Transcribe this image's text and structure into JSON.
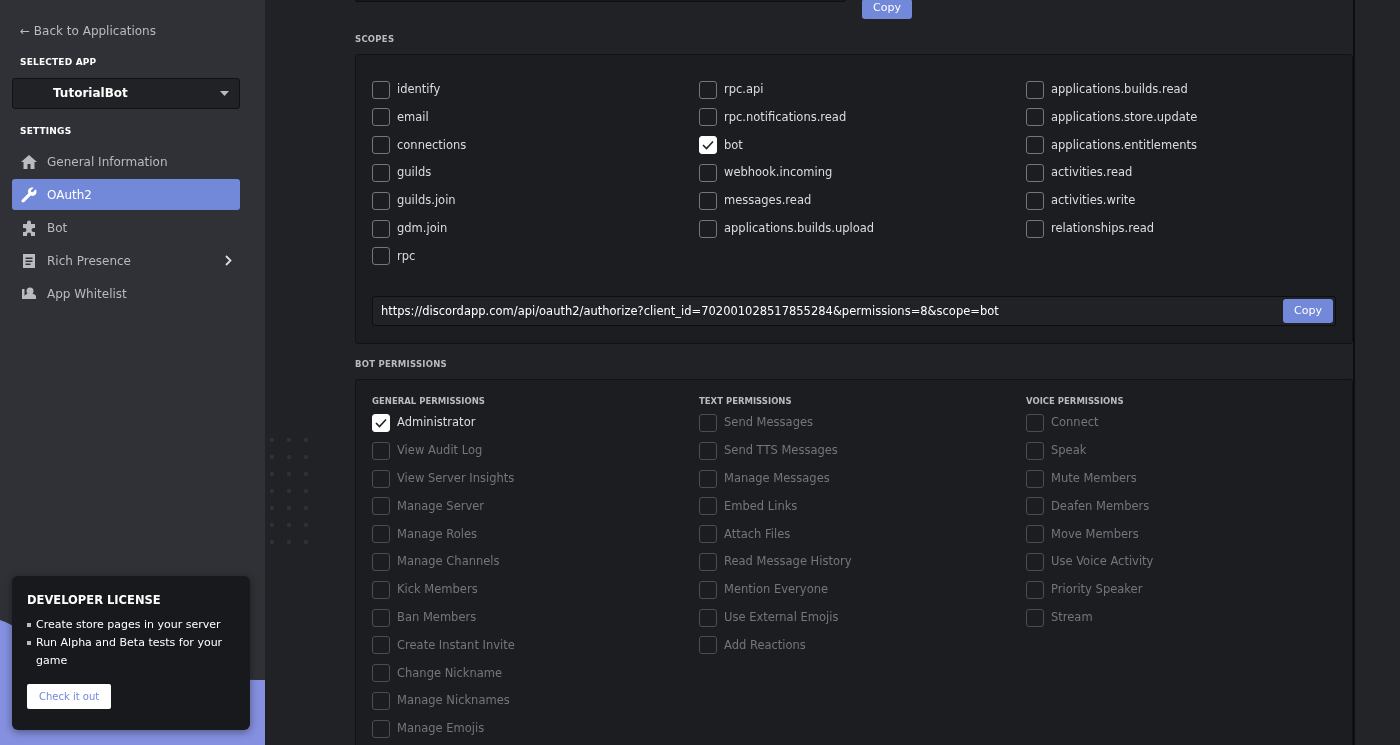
{
  "sidebar": {
    "back_link": "← Back to Applications",
    "selected_app_label": "SELECTED APP",
    "selected_app": "TutorialBot",
    "settings_label": "SETTINGS",
    "items": [
      {
        "label": "General Information",
        "selected": false,
        "expandable": false
      },
      {
        "label": "OAuth2",
        "selected": true,
        "expandable": false
      },
      {
        "label": "Bot",
        "selected": false,
        "expandable": false
      },
      {
        "label": "Rich Presence",
        "selected": false,
        "expandable": true
      },
      {
        "label": "App Whitelist",
        "selected": false,
        "expandable": false
      }
    ],
    "license_card": {
      "title": "DEVELOPER LICENSE",
      "bullets": [
        "Create store pages in your server",
        "Run Alpha and Beta tests for your game"
      ],
      "button": "Check it out"
    }
  },
  "top_copy_button": "Copy",
  "scopes": {
    "title": "SCOPES",
    "columns": [
      [
        {
          "label": "identify",
          "checked": false
        },
        {
          "label": "email",
          "checked": false
        },
        {
          "label": "connections",
          "checked": false
        },
        {
          "label": "guilds",
          "checked": false
        },
        {
          "label": "guilds.join",
          "checked": false
        },
        {
          "label": "gdm.join",
          "checked": false
        },
        {
          "label": "rpc",
          "checked": false
        }
      ],
      [
        {
          "label": "rpc.api",
          "checked": false
        },
        {
          "label": "rpc.notifications.read",
          "checked": false
        },
        {
          "label": "bot",
          "checked": true
        },
        {
          "label": "webhook.incoming",
          "checked": false
        },
        {
          "label": "messages.read",
          "checked": false
        },
        {
          "label": "applications.builds.upload",
          "checked": false
        }
      ],
      [
        {
          "label": "applications.builds.read",
          "checked": false
        },
        {
          "label": "applications.store.update",
          "checked": false
        },
        {
          "label": "applications.entitlements",
          "checked": false
        },
        {
          "label": "activities.read",
          "checked": false
        },
        {
          "label": "activities.write",
          "checked": false
        },
        {
          "label": "relationships.read",
          "checked": false
        }
      ]
    ],
    "url": "https://discordapp.com/api/oauth2/authorize?client_id=702001028517855284&permissions=8&scope=bot",
    "copy_button": "Copy"
  },
  "bot_permissions": {
    "title": "BOT PERMISSIONS",
    "groups": [
      {
        "title": "GENERAL PERMISSIONS",
        "items": [
          {
            "label": "Administrator",
            "checked": true,
            "disabled": false
          },
          {
            "label": "View Audit Log",
            "checked": false,
            "disabled": true
          },
          {
            "label": "View Server Insights",
            "checked": false,
            "disabled": true
          },
          {
            "label": "Manage Server",
            "checked": false,
            "disabled": true
          },
          {
            "label": "Manage Roles",
            "checked": false,
            "disabled": true
          },
          {
            "label": "Manage Channels",
            "checked": false,
            "disabled": true
          },
          {
            "label": "Kick Members",
            "checked": false,
            "disabled": true
          },
          {
            "label": "Ban Members",
            "checked": false,
            "disabled": true
          },
          {
            "label": "Create Instant Invite",
            "checked": false,
            "disabled": true
          },
          {
            "label": "Change Nickname",
            "checked": false,
            "disabled": true
          },
          {
            "label": "Manage Nicknames",
            "checked": false,
            "disabled": true
          },
          {
            "label": "Manage Emojis",
            "checked": false,
            "disabled": true
          }
        ]
      },
      {
        "title": "TEXT PERMISSIONS",
        "items": [
          {
            "label": "Send Messages",
            "checked": false,
            "disabled": true
          },
          {
            "label": "Send TTS Messages",
            "checked": false,
            "disabled": true
          },
          {
            "label": "Manage Messages",
            "checked": false,
            "disabled": true
          },
          {
            "label": "Embed Links",
            "checked": false,
            "disabled": true
          },
          {
            "label": "Attach Files",
            "checked": false,
            "disabled": true
          },
          {
            "label": "Read Message History",
            "checked": false,
            "disabled": true
          },
          {
            "label": "Mention Everyone",
            "checked": false,
            "disabled": true
          },
          {
            "label": "Use External Emojis",
            "checked": false,
            "disabled": true
          },
          {
            "label": "Add Reactions",
            "checked": false,
            "disabled": true
          }
        ]
      },
      {
        "title": "VOICE PERMISSIONS",
        "items": [
          {
            "label": "Connect",
            "checked": false,
            "disabled": true
          },
          {
            "label": "Speak",
            "checked": false,
            "disabled": true
          },
          {
            "label": "Mute Members",
            "checked": false,
            "disabled": true
          },
          {
            "label": "Deafen Members",
            "checked": false,
            "disabled": true
          },
          {
            "label": "Move Members",
            "checked": false,
            "disabled": true
          },
          {
            "label": "Use Voice Activity",
            "checked": false,
            "disabled": true
          },
          {
            "label": "Priority Speaker",
            "checked": false,
            "disabled": true
          },
          {
            "label": "Stream",
            "checked": false,
            "disabled": true
          }
        ]
      }
    ]
  }
}
